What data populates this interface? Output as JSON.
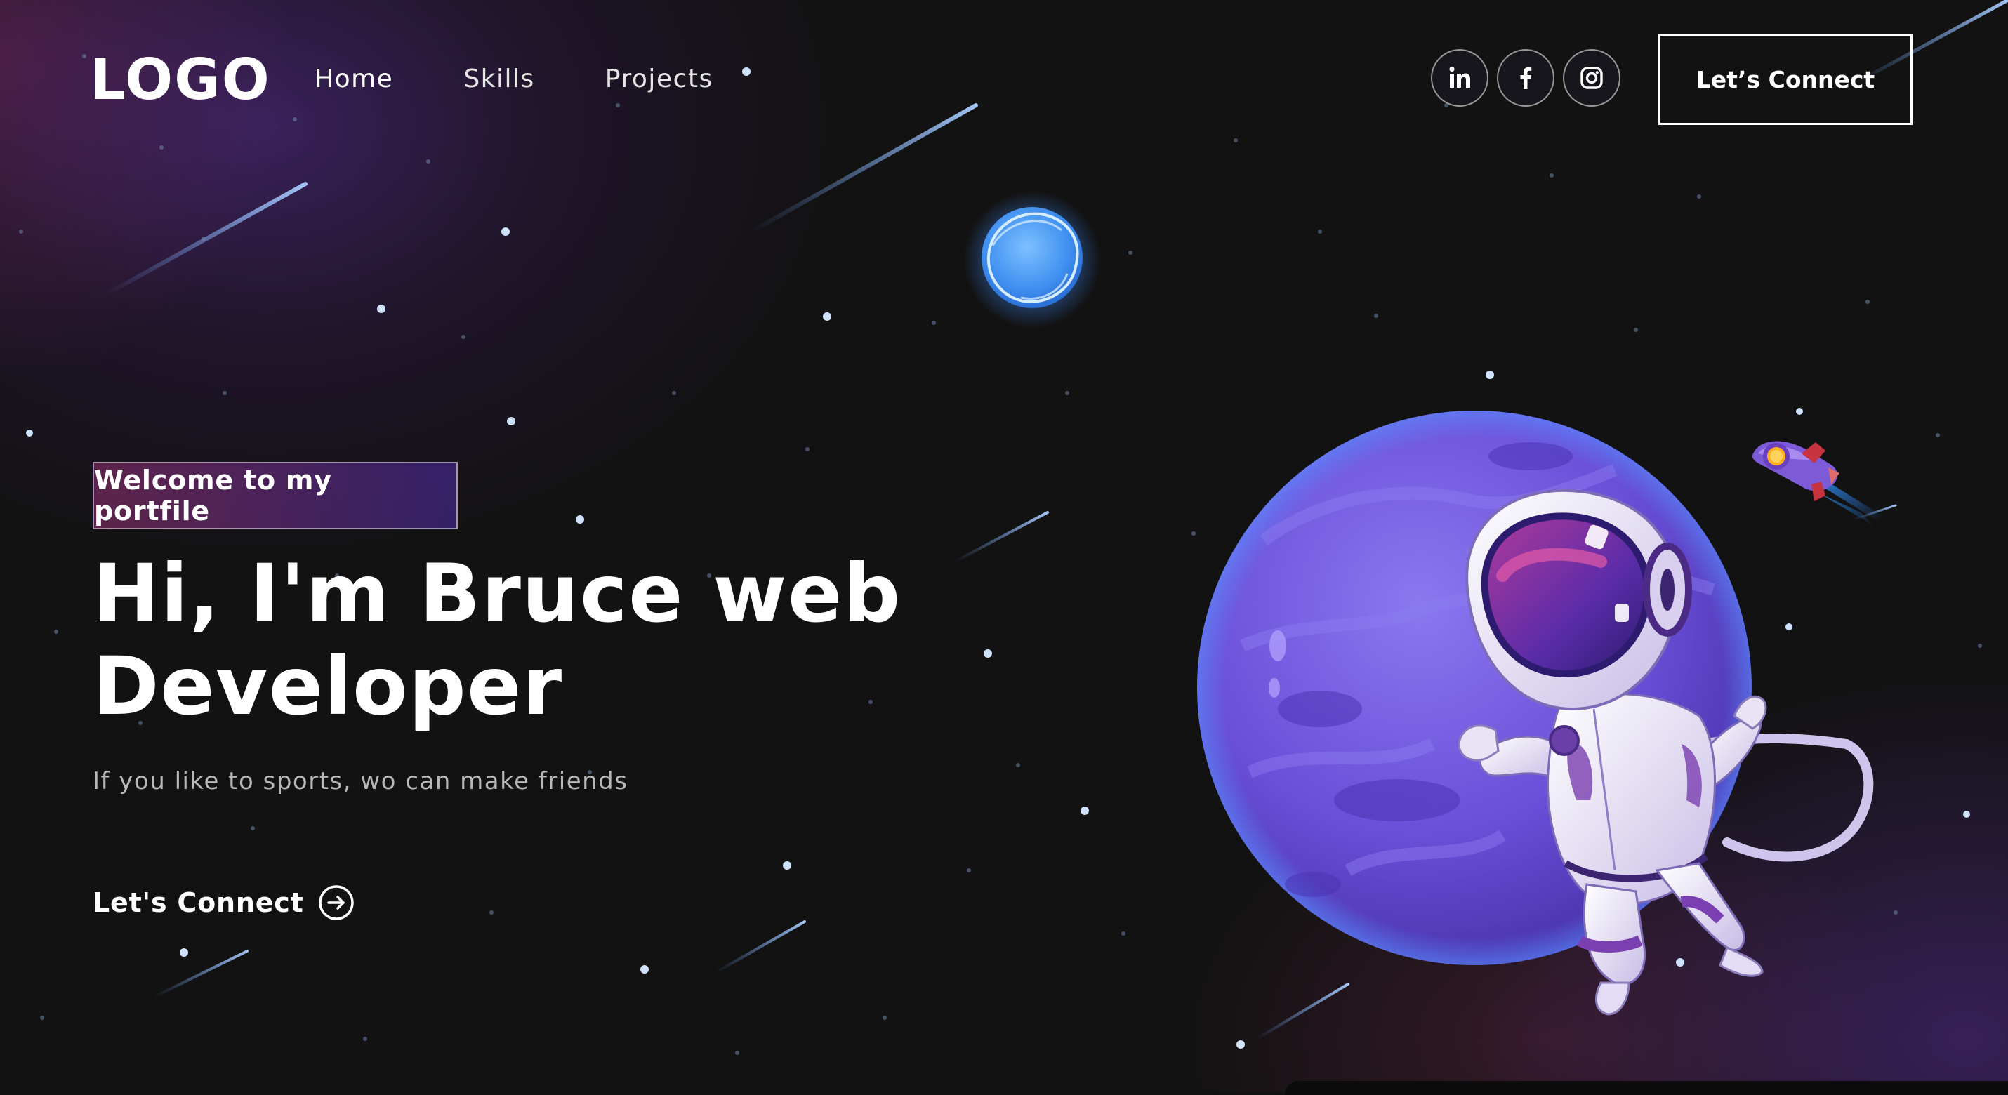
{
  "page": {
    "background_color": "#121212",
    "accent_gradient": [
      "#AA367C",
      "#4A2FBD"
    ]
  },
  "navbar": {
    "logo": "LOGO",
    "links": [
      {
        "label": "Home",
        "active": true
      },
      {
        "label": "Skills",
        "active": false
      },
      {
        "label": "Projects",
        "active": false
      }
    ],
    "social": [
      {
        "name": "linkedin-icon",
        "glyph": "in"
      },
      {
        "name": "facebook-icon",
        "glyph": "f"
      },
      {
        "name": "instagram-icon",
        "glyph": "instagram"
      }
    ],
    "connect_label": "Let’s Connect"
  },
  "hero": {
    "tagline": "Welcome to my portfile",
    "headline_line1": "Hi, I'm Bruce web",
    "headline_line2": "Developer",
    "subtitle": "If you like to sports, wo can make friends",
    "cta_label": "Let's Connect",
    "cta_icon": "arrow-right-circle-icon"
  },
  "illustration": {
    "main": "astronaut-on-purple-planet",
    "planet_color": "#6A4FD8",
    "small_planet_color": "#5AA9F5",
    "rocket": "rocket-icon"
  }
}
